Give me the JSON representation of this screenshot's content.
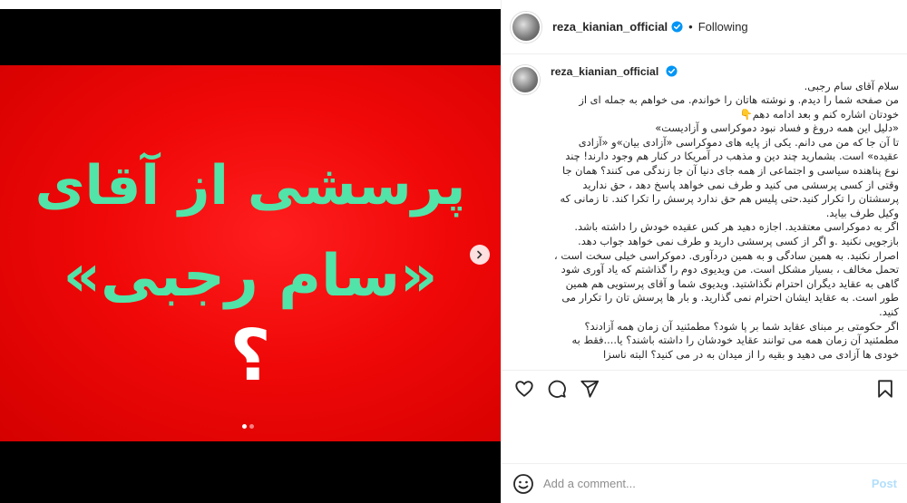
{
  "media": {
    "slide_line_1": "پرسشی از آقای",
    "slide_line_2": "«سام رجبی»",
    "slide_line_3": "؟",
    "slide_text_color": "#52e3a9",
    "slide_bg_color": "#f00808",
    "carousel_total": 2,
    "carousel_current": 1
  },
  "header": {
    "username": "reza_kianian_official",
    "separator": "•",
    "follow_label": "Following"
  },
  "caption": {
    "username": "reza_kianian_official",
    "text": "سلام آقای سام رجبی.\nمن صفحه شما را دیدم. و نوشته هاتان را خواندم. می خواهم به جمله ای از خودتان اشاره کنم و بعد ادامه دهم👇\n«دلیل این همه دروغ و فساد نبود دموکراسی و آزادیست»\nتا آن جا که من می دانم. یکی از پایه های دموکراسی «آزادی بیان»و «آزادی عقیده» است. بشمارید چند دین و مذهب در آمریکا در کنار هم وجود دارند! چند نوع پناهنده سیاسی و اجتماعی از همه جای دنیا آن جا زندگی می کنند؟ همان جا وقتی از کسی پرسشی می کنید و طرف نمی خواهد پاسخ دهد ، حق ندارید پرسشتان را تکرار کنید.حتی پلیس هم حق ندارد پرسش را تکرا کند. تا زمانی که وکیل طرف بیاید.\nاگر به دموکراسی معتقدید. اجازه دهید هر کس عقیده خودش را داشته باشد. بازجویی نکنید .و اگر از کسی پرسشی دارید و طرف نمی خواهد جواب دهد. اصرار نکنید. به همین سادگی و به همین دردآوری. دموکراسی خیلی سخت است ، تحمل مخالف ، بسیار مشکل است. من ویدیوی دوم را گذاشتم که یاد آوری شود گاهی به عقاید دیگران احترام نگذاشتید. ویدیوی شما و آقای پرستویی هم همین طور است. به عقاید ایشان احترام نمی گذارید. و بار ها پرسش تان را تکرار می کنید.\nاگر حکومتی بر مبنای عقاید شما بر پا شود؟ مطمئنید آن زمان همه آزادند؟ مطمئنید آن زمان همه می توانند عقاید خودشان را داشته باشند؟ یا....فقط به خودی ها آزادی می دهید و بقیه را از میدان به در می کنید؟ البته ناسزا"
  },
  "actions": {
    "like": "heart-icon",
    "comment": "comment-icon",
    "share": "share-icon",
    "save": "bookmark-icon"
  },
  "comment": {
    "placeholder": "Add a comment...",
    "post_label": "Post"
  },
  "colors": {
    "verified": "#0095f6",
    "post_disabled": "#b2dffc",
    "border": "#efefef"
  }
}
